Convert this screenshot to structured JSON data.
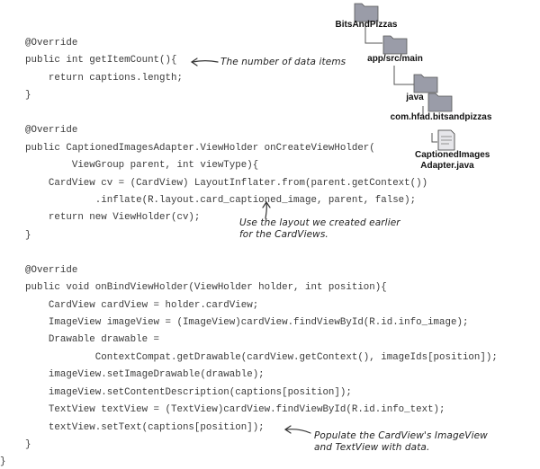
{
  "code_lines": [
    "@Override",
    "public int getItemCount(){",
    "    return captions.length;",
    "}",
    "",
    "@Override",
    "public CaptionedImagesAdapter.ViewHolder onCreateViewHolder(",
    "        ViewGroup parent, int viewType){",
    "    CardView cv = (CardView) LayoutInflater.from(parent.getContext())",
    "            .inflate(R.layout.card_captioned_image, parent, false);",
    "    return new ViewHolder(cv);",
    "}",
    "",
    "@Override",
    "public void onBindViewHolder(ViewHolder holder, int position){",
    "    CardView cardView = holder.cardView;",
    "    ImageView imageView = (ImageView)cardView.findViewById(R.id.info_image);",
    "    Drawable drawable =",
    "            ContextCompat.getDrawable(cardView.getContext(), imageIds[position]);",
    "    imageView.setImageDrawable(drawable);",
    "    imageView.setContentDescription(captions[position]);",
    "    TextView textView = (TextView)cardView.findViewById(R.id.info_text);",
    "    textView.setText(captions[position]);",
    "}"
  ],
  "closing_brace": "}",
  "annotations": {
    "item_count_note": "The number of data items",
    "layout_note": "Use the layout we created earlier for the CardViews.",
    "populate_note": "Populate the CardView's ImageView and TextView with data."
  },
  "file_tree": {
    "root": "BitsAndPizzas",
    "src": "app/src/main",
    "java": "java",
    "package": "com.hfad.bitsandpizzas",
    "file": "CaptionedImages Adapter.java",
    "folder_color": "#9a9ca8",
    "line_color": "#555555"
  }
}
